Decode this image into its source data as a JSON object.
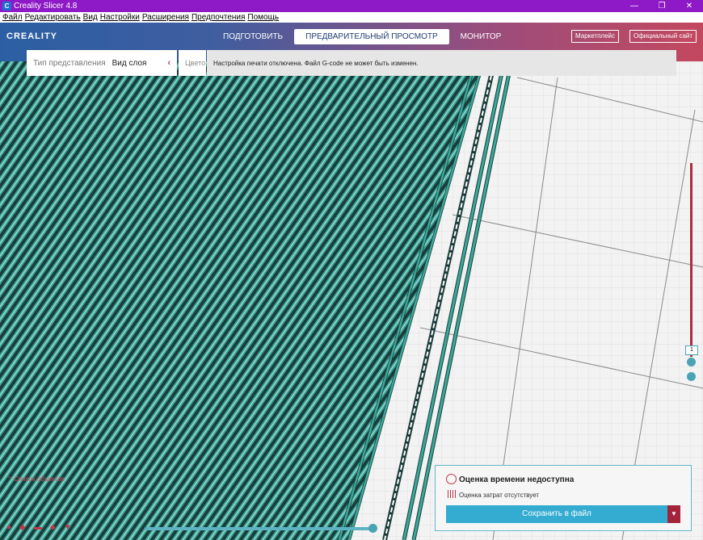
{
  "window": {
    "title": "Creality Slicer 4.8",
    "app_icon": "creality-app-icon",
    "controls": [
      "—",
      "❐",
      "✕"
    ]
  },
  "menu": [
    "Файл",
    "Редактировать",
    "Вид",
    "Настройки",
    "Расширения",
    "Предпочтения",
    "Помощь"
  ],
  "header": {
    "logo": "CREALITY",
    "tabs": [
      {
        "label": "ПОДГОТОВИТЬ",
        "active": false
      },
      {
        "label": "ПРЕДВАРИТЕЛЬНЫЙ ПРОСМОТР",
        "active": true
      },
      {
        "label": "МОНИТОР",
        "active": false
      }
    ],
    "marketplace": "Маркетплейс",
    "website": "Официальный сайт"
  },
  "view_type": {
    "label": "Тип представления",
    "value": "Вид слоя",
    "colors_stub": "Цвето"
  },
  "notice": "Настройка печати отключена. Файл G-code не может быть изменен.",
  "layer_slider": {
    "current": "1"
  },
  "object_list": {
    "label": "Список объектов"
  },
  "output": {
    "title": "Оценка времени недоступна",
    "cost": "Оценка затрат отсутствует",
    "save": "Сохранить в файл"
  },
  "colors": {
    "accent": "#c0384c",
    "teal": "#3aa79a",
    "primary_btn": "#34acd1"
  }
}
